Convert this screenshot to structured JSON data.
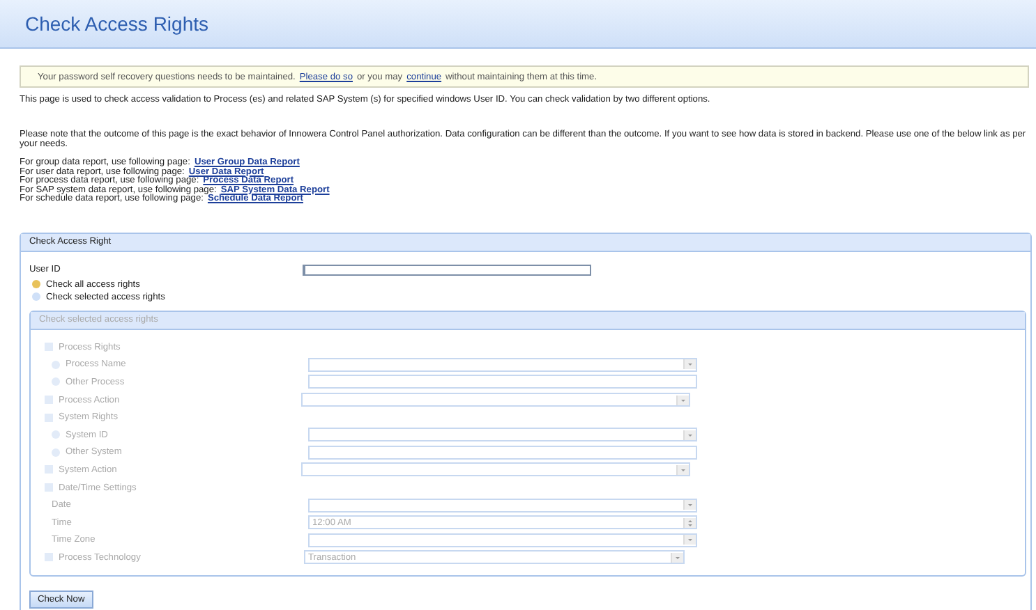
{
  "header": {
    "title": "Check Access Rights"
  },
  "notice": {
    "before": "Your password self recovery questions needs to be maintained.",
    "link1": "Please do so",
    "middle": "or you may",
    "link2": "continue",
    "after": "without maintaining them at this time."
  },
  "intro": "This page is used to check access validation to Process (es) and related SAP System (s) for specified windows User ID. You can check validation by two different options.",
  "note": "Please note that the outcome of this page is the exact behavior of Innowera Control Panel authorization. Data configuration can be different than the outcome. If you want to see how data is stored in backend. Please use one of the below link as per your needs.",
  "reports": [
    {
      "text": "For group data report, use following page:",
      "link": "User Group Data Report"
    },
    {
      "text": "For user data report, use following page:",
      "link": "User Data Report"
    },
    {
      "text": "For process data report, use following page:",
      "link": "Process Data Report"
    },
    {
      "text": "For SAP system data report, use following page:",
      "link": "SAP System Data Report"
    },
    {
      "text": "For schedule data report, use following page:",
      "link": "Schedule Data Report"
    }
  ],
  "panel": {
    "title": "Check Access Right",
    "user_id_label": "User ID",
    "options": [
      {
        "label": "Check all access rights",
        "selected": true
      },
      {
        "label": "Check selected access rights",
        "selected": false
      }
    ],
    "selected_panel": {
      "title": "Check selected access rights",
      "disabled": true,
      "rows": [
        {
          "kind": "checkbox",
          "label": "Process Rights",
          "checked": false,
          "children": [
            {
              "kind": "radio",
              "label": "Process Name",
              "selected": false,
              "field": {
                "kind": "select"
              }
            },
            {
              "kind": "radio",
              "label": "Other Process",
              "selected": false,
              "field": {
                "kind": "text"
              }
            }
          ]
        },
        {
          "kind": "checkbox",
          "label": "Process Action",
          "checked": false,
          "field": {
            "kind": "select"
          }
        },
        {
          "kind": "checkbox",
          "label": "System Rights",
          "checked": false,
          "children": [
            {
              "kind": "radio",
              "label": "System ID",
              "selected": false,
              "field": {
                "kind": "select"
              }
            },
            {
              "kind": "radio",
              "label": "Other System",
              "selected": false,
              "field": {
                "kind": "text"
              }
            }
          ]
        },
        {
          "kind": "checkbox",
          "label": "System Action",
          "checked": false,
          "field": {
            "kind": "select"
          }
        },
        {
          "kind": "checkbox",
          "label": "Date/Time Settings",
          "checked": false,
          "children": [
            {
              "kind": "plain",
              "label": "Date",
              "field": {
                "kind": "select"
              }
            },
            {
              "kind": "plain",
              "label": "Time",
              "field": {
                "kind": "spin",
                "value": "12:00 AM"
              }
            },
            {
              "kind": "plain",
              "label": "Time Zone",
              "field": {
                "kind": "select"
              }
            }
          ]
        },
        {
          "kind": "checkbox",
          "label": "Process Technology",
          "checked": false,
          "field": {
            "kind": "select",
            "value": "Transaction"
          }
        }
      ]
    },
    "button": "Check Now"
  }
}
